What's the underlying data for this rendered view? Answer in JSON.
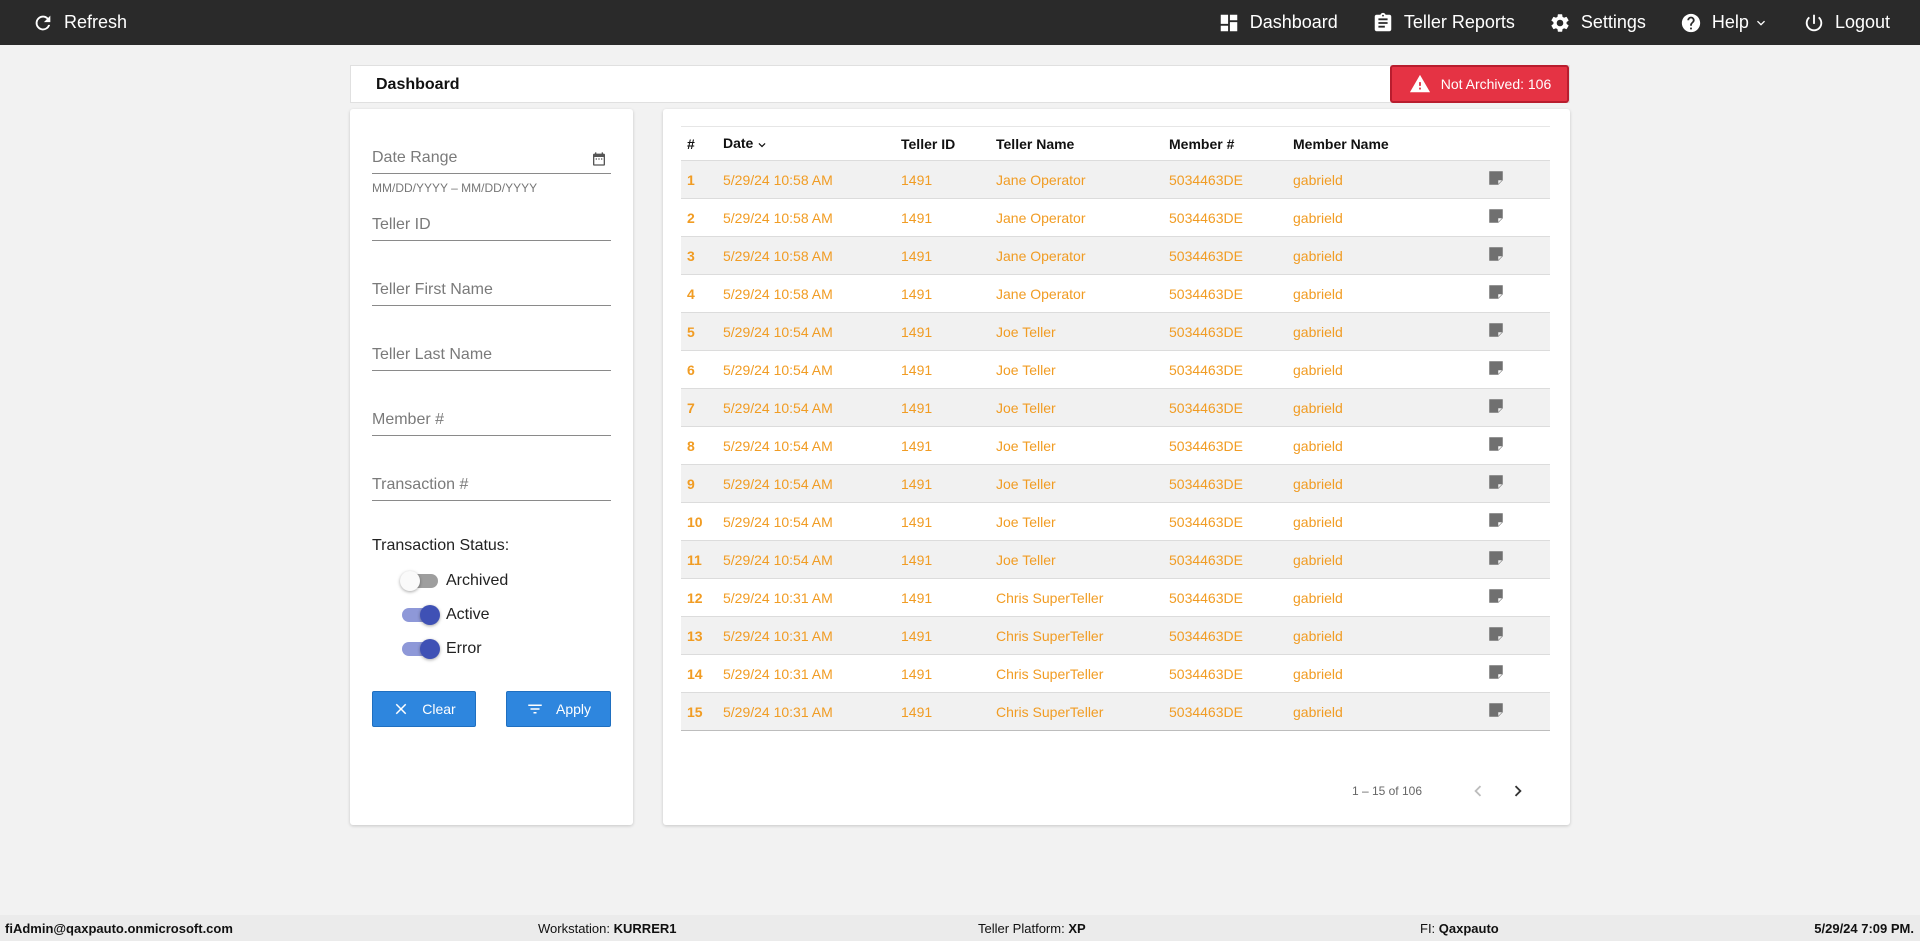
{
  "topbar": {
    "refresh_label": "Refresh",
    "nav": {
      "dashboard": "Dashboard",
      "teller_reports": "Teller Reports",
      "settings": "Settings",
      "help": "Help",
      "logout": "Logout"
    }
  },
  "page": {
    "title": "Dashboard",
    "badge": "Not Archived: 106",
    "badge_color": "#e53344"
  },
  "filters": {
    "date_range_placeholder": "Date Range",
    "date_hint": "MM/DD/YYYY – MM/DD/YYYY",
    "teller_id_placeholder": "Teller ID",
    "teller_first_placeholder": "Teller First Name",
    "teller_last_placeholder": "Teller Last Name",
    "member_placeholder": "Member #",
    "transaction_placeholder": "Transaction #",
    "status_label": "Transaction Status:",
    "toggles": [
      {
        "label": "Archived",
        "on": false
      },
      {
        "label": "Active",
        "on": true
      },
      {
        "label": "Error",
        "on": true
      }
    ],
    "clear_label": "Clear",
    "apply_label": "Apply",
    "button_color": "#2e86de"
  },
  "table": {
    "columns": [
      "#",
      "Date",
      "Teller ID",
      "Teller Name",
      "Member #",
      "Member Name"
    ],
    "link_color": "#f19c23",
    "rows": [
      [
        "1",
        "5/29/24 10:58 AM",
        "1491",
        "Jane Operator",
        "5034463DE",
        "gabrield"
      ],
      [
        "2",
        "5/29/24 10:58 AM",
        "1491",
        "Jane Operator",
        "5034463DE",
        "gabrield"
      ],
      [
        "3",
        "5/29/24 10:58 AM",
        "1491",
        "Jane Operator",
        "5034463DE",
        "gabrield"
      ],
      [
        "4",
        "5/29/24 10:58 AM",
        "1491",
        "Jane Operator",
        "5034463DE",
        "gabrield"
      ],
      [
        "5",
        "5/29/24 10:54 AM",
        "1491",
        "Joe Teller",
        "5034463DE",
        "gabrield"
      ],
      [
        "6",
        "5/29/24 10:54 AM",
        "1491",
        "Joe Teller",
        "5034463DE",
        "gabrield"
      ],
      [
        "7",
        "5/29/24 10:54 AM",
        "1491",
        "Joe Teller",
        "5034463DE",
        "gabrield"
      ],
      [
        "8",
        "5/29/24 10:54 AM",
        "1491",
        "Joe Teller",
        "5034463DE",
        "gabrield"
      ],
      [
        "9",
        "5/29/24 10:54 AM",
        "1491",
        "Joe Teller",
        "5034463DE",
        "gabrield"
      ],
      [
        "10",
        "5/29/24 10:54 AM",
        "1491",
        "Joe Teller",
        "5034463DE",
        "gabrield"
      ],
      [
        "11",
        "5/29/24 10:54 AM",
        "1491",
        "Joe Teller",
        "5034463DE",
        "gabrield"
      ],
      [
        "12",
        "5/29/24 10:31 AM",
        "1491",
        "Chris SuperTeller",
        "5034463DE",
        "gabrield"
      ],
      [
        "13",
        "5/29/24 10:31 AM",
        "1491",
        "Chris SuperTeller",
        "5034463DE",
        "gabrield"
      ],
      [
        "14",
        "5/29/24 10:31 AM",
        "1491",
        "Chris SuperTeller",
        "5034463DE",
        "gabrield"
      ],
      [
        "15",
        "5/29/24 10:31 AM",
        "1491",
        "Chris SuperTeller",
        "5034463DE",
        "gabrield"
      ]
    ],
    "pagination": "1 – 15 of 106"
  },
  "footer": {
    "user": "fiAdmin@qaxpauto.onmicrosoft.com",
    "workstation_label": "Workstation:",
    "workstation": "KURRER1",
    "platform_label": "Teller Platform:",
    "platform": "XP",
    "fi_label": "FI:",
    "fi": "Qaxpauto",
    "datetime": "5/29/24 7:09 PM."
  }
}
